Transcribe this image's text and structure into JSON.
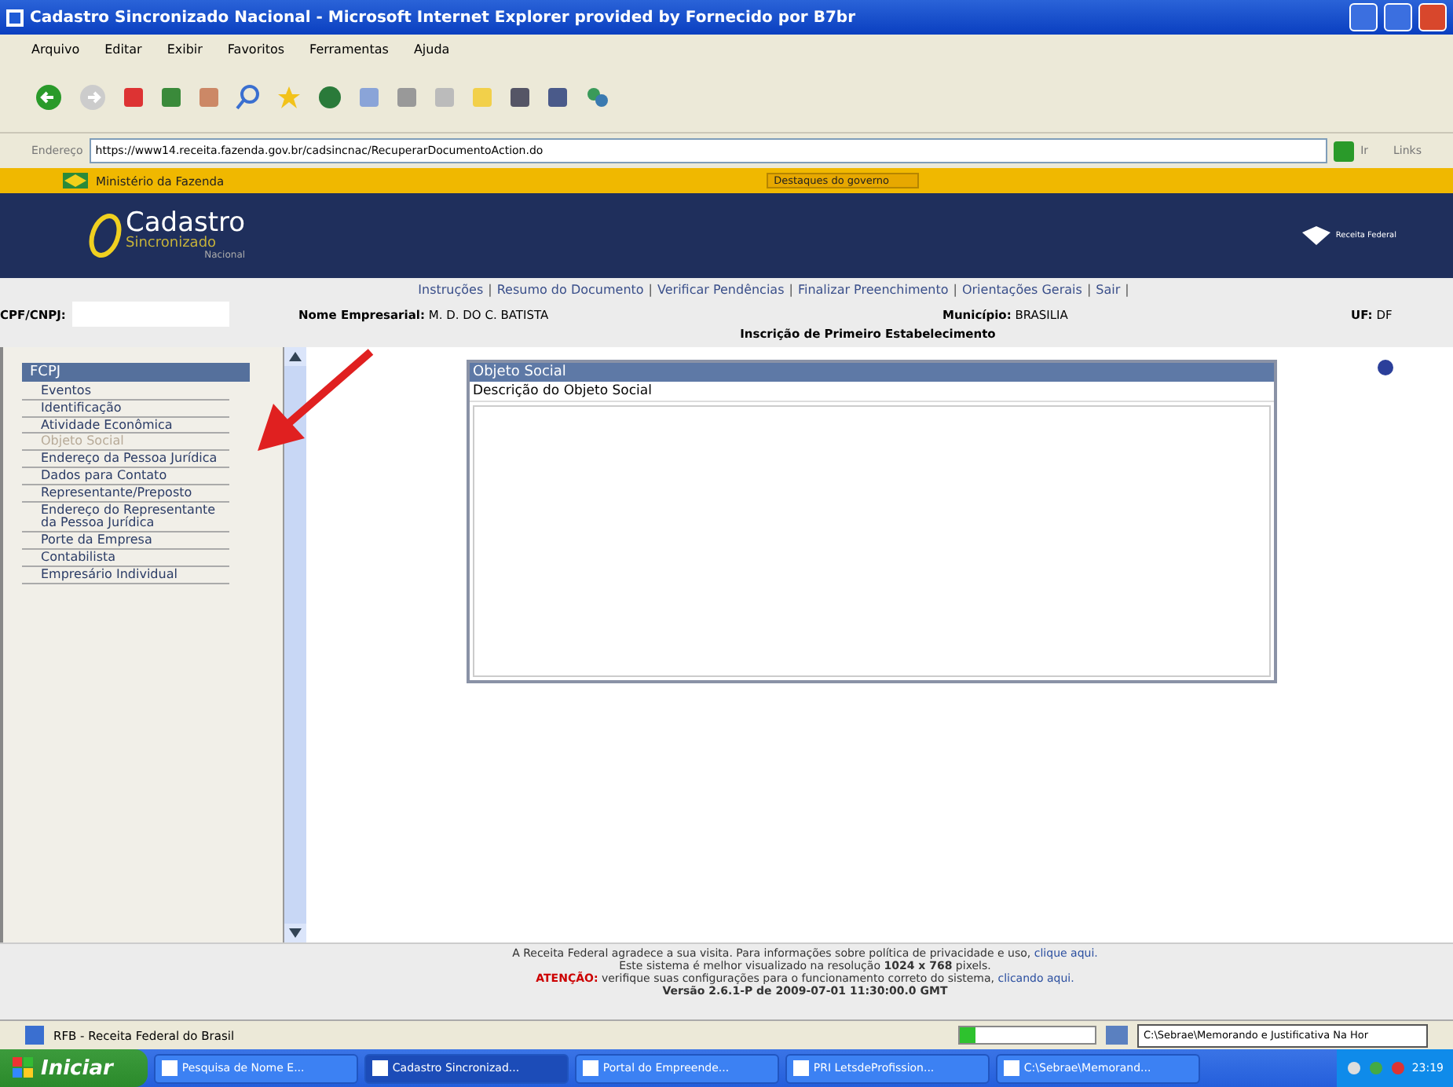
{
  "window": {
    "title": "Cadastro Sincronizado Nacional - Microsoft Internet Explorer provided by Fornecido por B7br"
  },
  "menu": [
    "Arquivo",
    "Editar",
    "Exibir",
    "Favoritos",
    "Ferramentas",
    "Ajuda"
  ],
  "address": {
    "label": "Endereço",
    "value": "https://www14.receita.fazenda.gov.br/cadsincnac/RecuperarDocumentoAction.do",
    "go": "Ir",
    "links": "Links"
  },
  "gov_bar": {
    "ministry": "Ministério da Fazenda",
    "dropdown": "Destaques do governo"
  },
  "header": {
    "logo_title": "Cadastro",
    "logo_sub": "Sincronizado",
    "logo_small": "Nacional",
    "right_logo": "Receita Federal"
  },
  "nav_links": [
    "Instruções",
    "Resumo do Documento",
    "Verificar Pendências",
    "Finalizar Preenchimento",
    "Orientações Gerais",
    "Sair"
  ],
  "nav_separator": "|",
  "info": {
    "cpf_label": "CPF/CNPJ:",
    "name_label": "Nome Empresarial:",
    "name_value": "M. D. DO C. BATISTA",
    "city_label": "Município:",
    "city_value": "BRASILIA",
    "uf_label": "UF:",
    "uf_value": "DF",
    "title": "Inscrição de Primeiro Estabelecimento"
  },
  "sidebar": {
    "heading": "FCPJ",
    "items": [
      {
        "label": "Eventos",
        "selected": false
      },
      {
        "label": "Identificação",
        "selected": false
      },
      {
        "label": "Atividade Econômica",
        "selected": false
      },
      {
        "label": "Objeto Social",
        "selected": true
      },
      {
        "label": "Endereço da Pessoa Jurídica",
        "selected": false
      },
      {
        "label": "Dados para Contato",
        "selected": false
      },
      {
        "label": "Representante/Preposto",
        "selected": false
      },
      {
        "label": "Endereço do Representante da Pessoa Jurídica",
        "selected": false
      },
      {
        "label": "Porte da Empresa",
        "selected": false
      },
      {
        "label": "Contabilista",
        "selected": false
      },
      {
        "label": "Empresário Individual",
        "selected": false
      }
    ]
  },
  "panel": {
    "title": "Objeto Social",
    "field_label": "Descrição do Objeto Social"
  },
  "footer": {
    "line1": "A Receita Federal agradece a sua visita. Para informações sobre política de privacidade e uso, ",
    "line1_link": "clique aqui.",
    "line2": "Este sistema é melhor visualizado na resolução **1024 x 768** pixels.",
    "attention": "ATENÇÃO:",
    "line3": " verifique suas configurações para o funcionamento correto do sistema, ",
    "line3_link": "clicando aqui.",
    "version": "Versão 2.6.1-P de 2009-07-01 11:30:00.0 GMT"
  },
  "status_bar": {
    "text": "RFB - Receita Federal do Brasil",
    "level": 0.12,
    "path": "C:\\Sebrae\\Memorando e Justificativa Na Hor"
  },
  "taskbar": {
    "start": "Iniciar",
    "tasks": [
      {
        "label": "Pesquisa de Nome E...",
        "selected": false
      },
      {
        "label": "Cadastro Sincronizad...",
        "selected": true
      },
      {
        "label": "Portal do Empreende...",
        "selected": false
      },
      {
        "label": "PRI LetsdeProfission...",
        "selected": false
      },
      {
        "label": "C:\\Sebrae\\Memorand...",
        "selected": false
      }
    ],
    "clock": "23:19"
  }
}
